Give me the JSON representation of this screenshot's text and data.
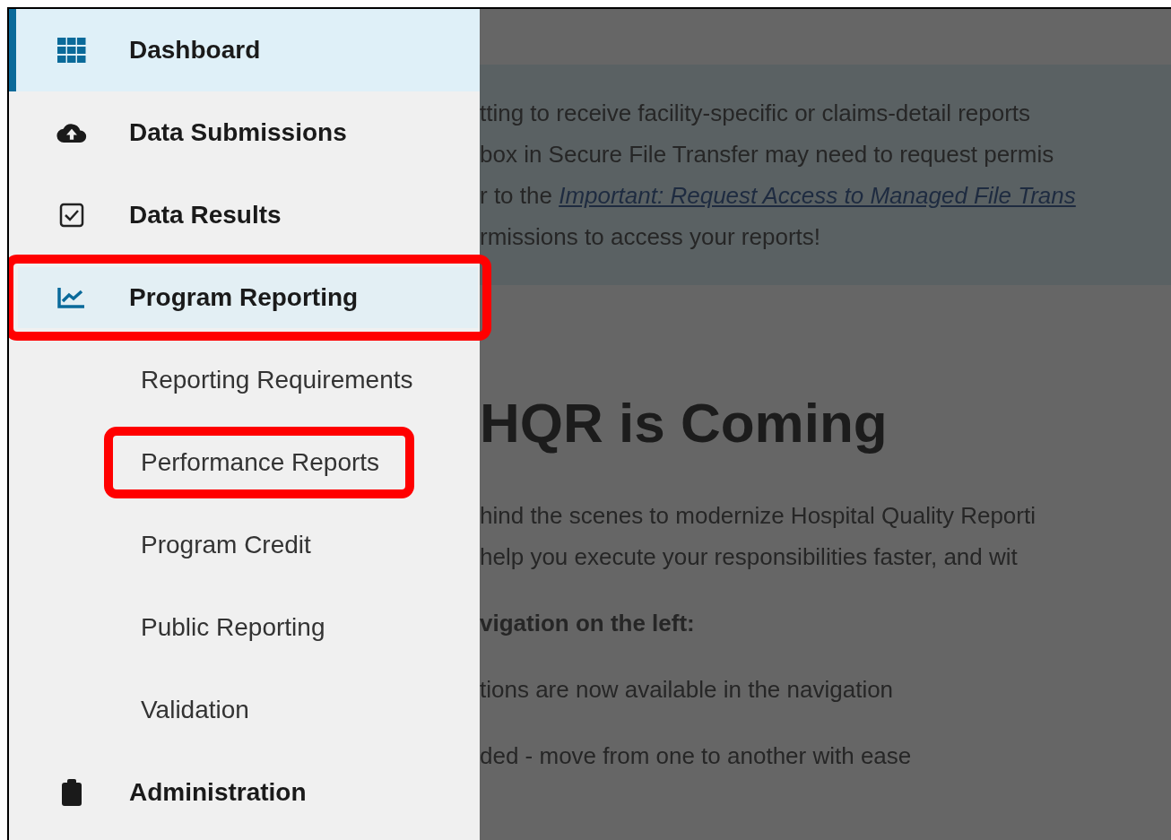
{
  "sidebar": {
    "items": [
      {
        "label": "Dashboard",
        "selected": true,
        "highlighted": false
      },
      {
        "label": "Data Submissions",
        "selected": false,
        "highlighted": false
      },
      {
        "label": "Data Results",
        "selected": false,
        "highlighted": false
      },
      {
        "label": "Program Reporting",
        "selected": false,
        "expanded": true,
        "highlighted": true,
        "children": [
          {
            "label": "Reporting Requirements",
            "highlighted": false
          },
          {
            "label": "Performance Reports",
            "highlighted": true
          },
          {
            "label": "Program Credit",
            "highlighted": false
          },
          {
            "label": "Public Reporting",
            "highlighted": false
          },
          {
            "label": "Validation",
            "highlighted": false
          }
        ]
      },
      {
        "label": "Administration",
        "selected": false,
        "highlighted": false
      }
    ]
  },
  "content": {
    "banner": [
      {
        "text": "tting to receive facility-specific or claims-detail reports"
      },
      {
        "text": "box in Secure File Transfer may need to request permis"
      },
      {
        "text": "r to the ",
        "link": "Important: Request Access to Managed File Trans"
      },
      {
        "text": "rmissions to access your reports!"
      }
    ],
    "heading": "HQR is Coming",
    "paragraphs": [
      {
        "text": "hind the scenes to modernize Hospital Quality Reporti",
        "bold": false
      },
      {
        "text": "help you execute your responsibilities faster, and wit",
        "bold": false
      },
      {
        "text": "vigation on the left:",
        "bold": true
      },
      {
        "text": "tions are now available in the navigation",
        "bold": false
      },
      {
        "text": "ded - move from one to another with ease",
        "bold": false
      }
    ]
  }
}
